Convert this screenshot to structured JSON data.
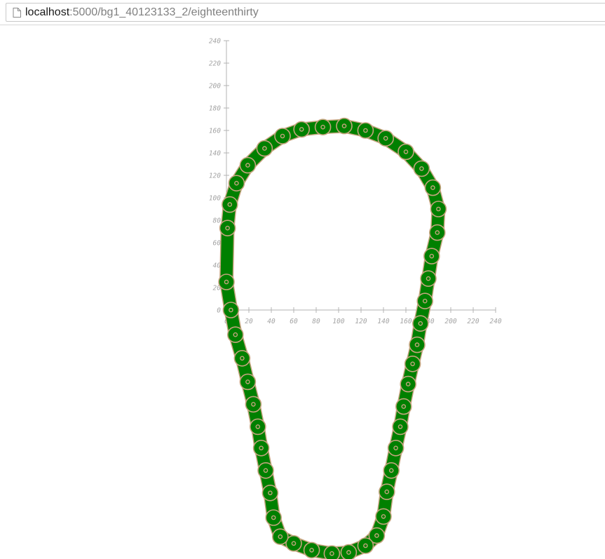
{
  "browser": {
    "url_host": "localhost",
    "url_path": ":5000/bg1_40123133_2/eighteenthirty",
    "page_icon": "page-icon"
  },
  "colors": {
    "chain_fill": "#008000",
    "chain_outline": "#c4a47e",
    "pin": "#c4a47e",
    "axis": "#b3b3b3",
    "tick_label": "#a3a3a3"
  },
  "chart_data": {
    "type": "line",
    "title": "",
    "xlabel": "",
    "ylabel": "",
    "xlim": [
      0,
      240
    ],
    "ylim": [
      -200,
      240
    ],
    "x_ticks": [
      "0",
      "20",
      "40",
      "60",
      "80",
      "100",
      "120",
      "140",
      "160",
      "180",
      "200",
      "220",
      "240"
    ],
    "y_ticks": [
      "0",
      "20",
      "40",
      "60",
      "80",
      "100",
      "120",
      "140",
      "160",
      "180",
      "200",
      "220",
      "240"
    ],
    "grid": false,
    "legend": "none",
    "series": [
      {
        "marker": "chain-link",
        "x": [
          3,
          9,
          19,
          34,
          50,
          67,
          86,
          105,
          124,
          142,
          160,
          174,
          184,
          189,
          188,
          183,
          180,
          177,
          173,
          170,
          166,
          162,
          158,
          155,
          151,
          147,
          143,
          140,
          134,
          124,
          109,
          94,
          76,
          60,
          48,
          42,
          39,
          35,
          31,
          28,
          24,
          19,
          14,
          8,
          4,
          0,
          1
        ],
        "y": [
          94,
          113,
          129,
          144,
          155,
          161,
          163,
          164,
          160,
          153,
          141,
          126,
          109,
          90,
          69,
          48,
          28,
          8,
          -12,
          -31,
          -48,
          -66,
          -86,
          -104,
          -123,
          -143,
          -162,
          -184,
          -201,
          -210,
          -216,
          -217,
          -214,
          -208,
          -202,
          -185,
          -163,
          -143,
          -123,
          -104,
          -84,
          -64,
          -43,
          -22,
          0,
          25,
          73
        ]
      }
    ]
  }
}
